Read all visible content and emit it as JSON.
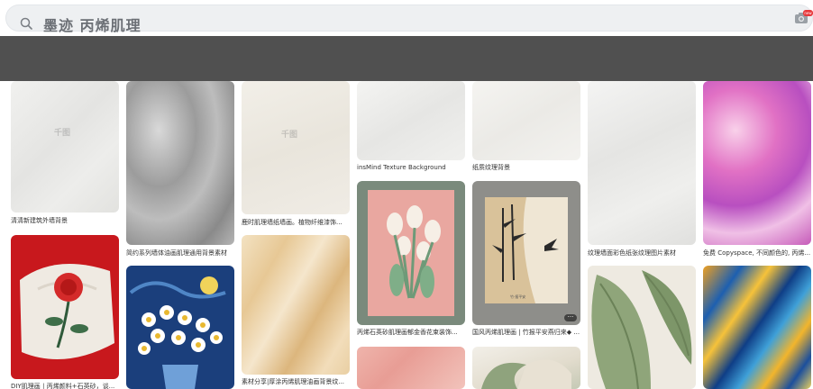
{
  "search": {
    "query": "墨迹 丙烯肌理",
    "badge": "new"
  },
  "results": [
    {
      "caption": "清清新建筑外墙背景",
      "watermark": "千图"
    },
    {
      "caption": "DIY肌理画丨丙烯颜料+石英砂，谈..."
    },
    {
      "caption": "简约系列墙体油画肌理通用背景素材"
    },
    {
      "caption": ""
    },
    {
      "caption": "鹿时肌理墙纸墙画。植物纤维漆饰...",
      "watermark": "千图"
    },
    {
      "caption": "素材分享|厚涂丙烯肌理油画背景纹..."
    },
    {
      "caption": "insMind Texture Background"
    },
    {
      "caption": "丙烯石英砂肌理画郁金香花束装饰..."
    },
    {
      "caption": ""
    },
    {
      "caption": "纸质纹理背景"
    },
    {
      "caption": "国风丙烯肌理画 | 竹报平安燕归来◆ ...",
      "more": "···",
      "art_caption": "竹·报平安"
    },
    {
      "caption": ""
    },
    {
      "caption": "纹理墙面彩色纸张纹理图片素材"
    },
    {
      "caption": ""
    },
    {
      "caption": "免费 Copyspace, 不同颜色的, 丙烯..."
    },
    {
      "caption": ""
    }
  ],
  "colors": {
    "dark_band": "#505050",
    "search_bg": "#eef0f2",
    "badge": "#e8373a"
  }
}
